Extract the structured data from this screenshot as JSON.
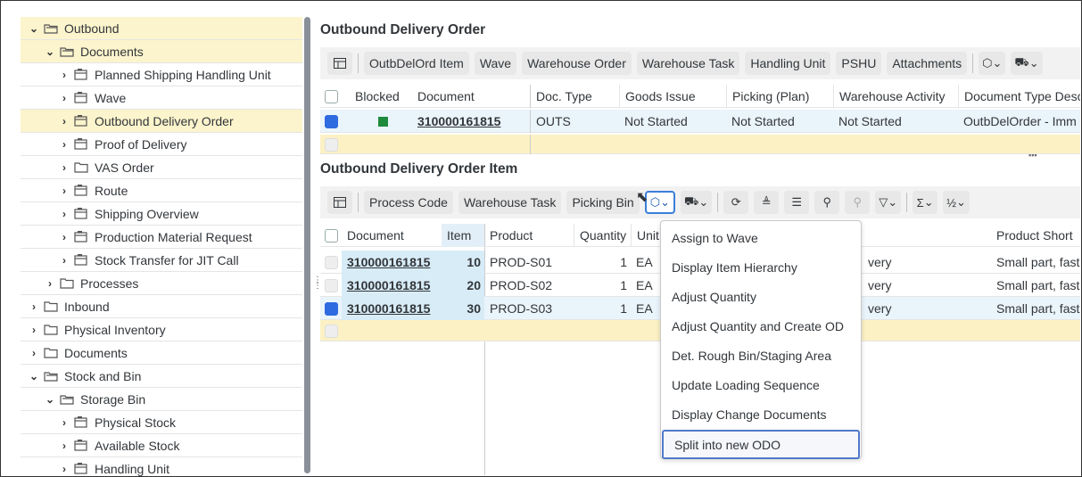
{
  "tree": {
    "items": [
      {
        "label": "Outbound",
        "arrow": "⌄",
        "icon": "folder-open"
      },
      {
        "label": "Documents",
        "arrow": "⌄",
        "icon": "folder-open"
      },
      {
        "label": "Planned Shipping Handling Unit",
        "arrow": "›",
        "icon": "node"
      },
      {
        "label": "Wave",
        "arrow": "›",
        "icon": "node"
      },
      {
        "label": "Outbound Delivery Order",
        "arrow": "›",
        "icon": "node"
      },
      {
        "label": "Proof of Delivery",
        "arrow": "›",
        "icon": "node"
      },
      {
        "label": "VAS Order",
        "arrow": "›",
        "icon": "folder"
      },
      {
        "label": "Route",
        "arrow": "›",
        "icon": "node"
      },
      {
        "label": "Shipping Overview",
        "arrow": "›",
        "icon": "node"
      },
      {
        "label": "Production Material Request",
        "arrow": "›",
        "icon": "node"
      },
      {
        "label": "Stock Transfer for JIT Call",
        "arrow": "›",
        "icon": "node"
      },
      {
        "label": "Processes",
        "arrow": "›",
        "icon": "folder"
      },
      {
        "label": "Inbound",
        "arrow": "›",
        "icon": "folder"
      },
      {
        "label": "Physical Inventory",
        "arrow": "›",
        "icon": "folder"
      },
      {
        "label": "Documents",
        "arrow": "›",
        "icon": "folder"
      },
      {
        "label": "Stock and Bin",
        "arrow": "⌄",
        "icon": "folder-open"
      },
      {
        "label": "Storage Bin",
        "arrow": "⌄",
        "icon": "folder-open"
      },
      {
        "label": "Physical Stock",
        "arrow": "›",
        "icon": "node"
      },
      {
        "label": "Available Stock",
        "arrow": "›",
        "icon": "node"
      },
      {
        "label": "Handling Unit",
        "arrow": "›",
        "icon": "node"
      }
    ]
  },
  "odo": {
    "title": "Outbound Delivery Order",
    "toolbar": {
      "buttons": [
        "OutbDelOrd Item",
        "Wave",
        "Warehouse Order",
        "Warehouse Task",
        "Handling Unit",
        "PSHU",
        "Attachments"
      ],
      "icon1": "⌄",
      "icon2": "⌄"
    },
    "columns": [
      "Blocked",
      "Document",
      "Doc. Type",
      "Goods Issue",
      "Picking (Plan)",
      "Warehouse Activity",
      "Document Type Desc"
    ],
    "rows": [
      {
        "document": "310000161815",
        "doc_type": "OUTS",
        "goods_issue": "Not Started",
        "picking_plan": "Not Started",
        "warehouse_activity": "Not Started",
        "doc_type_desc": "OutbDelOrder - Imm"
      }
    ],
    "blocked_color": "#1e8a3c"
  },
  "odoi": {
    "title": "Outbound Delivery Order Item",
    "toolbar": {
      "buttons": [
        "Process Code",
        "Warehouse Task",
        "Picking Bin"
      ]
    },
    "columns": [
      "Document",
      "Item",
      "Product",
      "Quantity",
      "Unit",
      "Product Short"
    ],
    "rows": [
      {
        "document": "310000161815",
        "item": "10",
        "product": "PROD-S01",
        "quantity": "1",
        "unit": "EA",
        "status": "very",
        "short": "Small part, fast"
      },
      {
        "document": "310000161815",
        "item": "20",
        "product": "PROD-S02",
        "quantity": "1",
        "unit": "EA",
        "status": "very",
        "short": "Small part, fast"
      },
      {
        "document": "310000161815",
        "item": "30",
        "product": "PROD-S03",
        "quantity": "1",
        "unit": "EA",
        "status": "very",
        "short": "Small part, fast"
      }
    ]
  },
  "menu": {
    "items": [
      "Assign to Wave",
      "Display Item Hierarchy",
      "Adjust Quantity",
      "Adjust Quantity and Create OD",
      "Det. Rough Bin/Staging Area",
      "Update Loading Sequence",
      "Display Change Documents",
      "Split into new ODO"
    ]
  },
  "colors": {
    "selected_row": "#fcf4cc",
    "accent": "#2f6be0",
    "highlight_cell": "#d8ecf7"
  }
}
